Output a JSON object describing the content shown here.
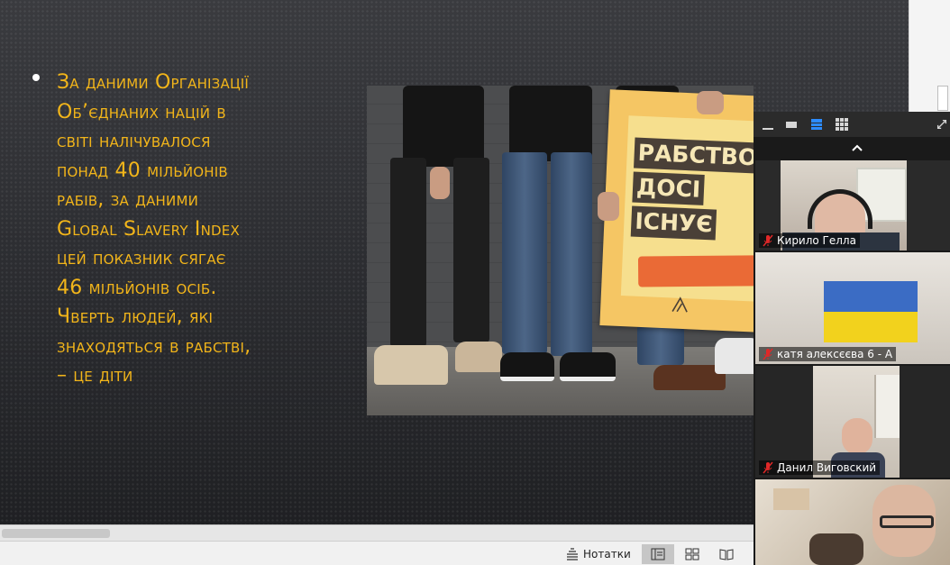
{
  "slide": {
    "bullet_text": "За даними Організації\nОб’єднаних націй в\nсвіті налічувалося\nпонад 40 мільйонів\nрабів, за даними\nGlobal Slavery Index\nцей показник сягає\n46 мільйонів осіб.\nЧверть людей, які\nзнаходяться в рабстві,\n– це діти",
    "text_color": "#f2b51a",
    "poster": {
      "line1": "РАБСТВО",
      "line2": "ДОСІ",
      "line3": "ІСНУЄ",
      "logo_icon": "a21-logo-icon"
    }
  },
  "statusbar": {
    "notes_label": "Нотатки",
    "notes_icon": "notes-icon",
    "views": [
      "normal-view-icon",
      "slide-sorter-icon",
      "reading-view-icon"
    ]
  },
  "video_panel": {
    "toolbar_icons": [
      "minimize-icon",
      "speaker-view-icon",
      "strip-view-icon",
      "gallery-view-icon",
      "expand-icon"
    ],
    "scroll_up_icon": "chevron-up-icon",
    "participants": [
      {
        "name": "Кирило Гелла",
        "muted": true
      },
      {
        "name": "катя алексєєва 6 - А",
        "muted": true
      },
      {
        "name": "Данил Виговский",
        "muted": true
      },
      {
        "name": "",
        "muted": false
      }
    ]
  }
}
